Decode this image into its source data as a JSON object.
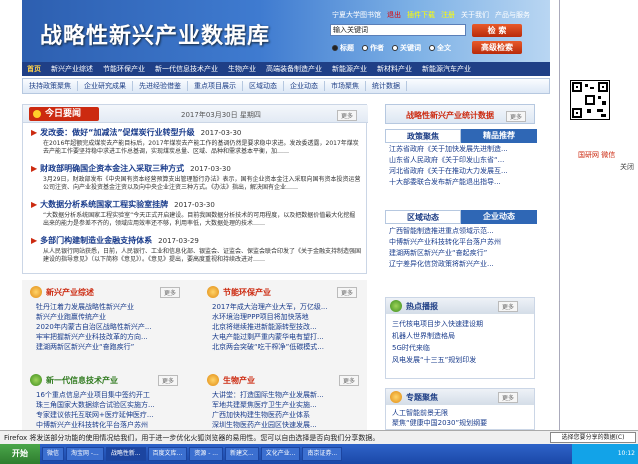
{
  "header": {
    "title": "战略性新兴产业数据库",
    "top_links": [
      "宁夏大学图书馆",
      "退出",
      "插件下载",
      "注册",
      "关于我们",
      "产品与服务"
    ],
    "search_placeholder": "输入关键词",
    "search_button": "检 索",
    "advanced_button": "高级检索",
    "radio_options": [
      "标题",
      "作者",
      "关键词",
      "全文"
    ]
  },
  "nav_primary": [
    "首页",
    "新兴产业综述",
    "节能环保产业",
    "新一代信息技术产业",
    "生物产业",
    "高端装备制造产业",
    "新能源产业",
    "新材料产业",
    "新能源汽车产业"
  ],
  "nav_secondary": [
    "扶持政策聚焦",
    "企业研究成果",
    "先进经验借鉴",
    "重点项目展示",
    "区域动态",
    "企业动态",
    "市场聚焦",
    "统计数据"
  ],
  "today_news": {
    "label": "今日要闻",
    "date": "2017年03月30日 星期四",
    "more": "更多",
    "items": [
      {
        "title": "发改委：做好“加减法”促煤炭行业转型升级",
        "date": "2017-03-30",
        "text": "在2016年超额完成煤炭去产能目标后，2017年煤炭去产能工作的基调仍然是要求稳中求进。发改委透露，2017年煤炭去产能工作要坚持稳中求进工作总基调，实现煤炭总量、区域、品种和需求基本平衡，加……"
      },
      {
        "title": "财政部明确国企资本金注入采取三种方式",
        "date": "2017-03-30",
        "text": "3月29日，财政部发布《中央国有资本经营预算支出管理暂行办法》表示，国有企业资本金注入采取向国有资本投资运营公司注资、向产业投资基金注资以及向中央企业注资三种方式。《办法》指出，解决国有企业……"
      },
      {
        "title": "大数据分析系统国家工程实验室挂牌",
        "date": "2017-03-30",
        "text": "“大数据分析系统国家工程实验室”今天正式开启建设。目前我国数据分析技术的可用程度，以及把数据价值最大化挖掘出来的能力是参差不齐的，领域应用效率还不够，利用率低，大数据处理的技术……"
      },
      {
        "title": "多部门构建制造业金融支持体系",
        "date": "2017-03-29",
        "text": "从人民银行网站获悉，日前，人民银行、工业和信息化部、银监会、证监会、保监会联合印发了《关于金融支持制造强国建设的指导意见》（以下简称《意见》）。《意见》提出，要高度重视和持续改进对……"
      }
    ]
  },
  "stats": {
    "label": "战略性新兴产业统计数据",
    "more": "更多"
  },
  "policy": {
    "tabs": [
      "政策聚焦",
      "精品推荐"
    ],
    "items": [
      "江苏省政府《关于加快发展先进制造...",
      "山东省人民政府《关于印发山东省“...",
      "河北省政府《关于在推动大力发展互...",
      "十大部委联合发布新产能退出指导..."
    ]
  },
  "region": {
    "tabs": [
      "区域动态",
      "企业动态"
    ],
    "items": [
      "广西智能制造推进重点领域示范...",
      "中博新兴产业科技转化平台落户苏州",
      "建湖两新区新兴产业“奋起疾行”",
      "辽宁差异化信贷政策将新兴产业..."
    ]
  },
  "hot": {
    "label": "热点播报",
    "more": "更多",
    "items": [
      "三代核电项目步入快速建设期",
      "机器人世界制造格局",
      "5G时代来临",
      "风电发展“十三五”规划印发"
    ]
  },
  "topic": {
    "label": "专题聚焦",
    "more": "更多",
    "items": [
      "人工智能前景无限",
      "聚焦“健康中国2030”规划纲要"
    ]
  },
  "categories": [
    {
      "label": "新兴产业综述",
      "more": "更多",
      "items": [
        "牡丹江着力发展战略性新兴产业",
        "新兴产业跑赢传统产业",
        "2020年内蒙古自治区战略性新兴产...",
        "牢牢把握新兴产业科技改革的方向...",
        "建湖两新区新兴产业“奋跑疾行”"
      ]
    },
    {
      "label": "节能环保产业",
      "more": "更多",
      "items": [
        "2017年成大治理产业大军，万亿级...",
        "水环境治理PPP项目将加快落地",
        "北京将继续推进新能源转型技改...",
        "大电产能过剩严重内蒙华电有望打...",
        "北京两会突破“吃干榨净”低碳模式..."
      ]
    },
    {
      "label": "新一代信息技术产业",
      "more": "更多",
      "items": [
        "16个重点信息产业项目集中签约开工",
        "珠三角国家大数据综合试验区实施方...",
        "专家建议依托互联网+医疗延伸医疗...",
        "中博新兴产业科技转化平台落户苏州",
        "人工智能拉动信息消费新浪潮"
      ]
    },
    {
      "label": "生物产业",
      "more": "更多",
      "items": [
        "大讲堂：打造国际生物产业发展新...",
        "军地共建聚焦医疗卫生产业实施...",
        "广西加快构建生物医药产业体系",
        "深圳生物医药产业园区快速发展...",
        "生物产业迎政策红利扩大医疗..."
      ]
    }
  ],
  "qr": {
    "caption": "国研网 微信",
    "close": "关闭"
  },
  "statusbar": {
    "text": "Firefox 将发送部分功能的使用情况给我们，用于进一步优化火狐浏览器的易用性。您可以自由选择是否向我们分享数据。",
    "button": "选择您要分享的数据(C)"
  },
  "taskbar": {
    "start": "开始",
    "tasks": [
      "微信",
      "淘宝网 -...",
      "战略性新...",
      "百度文库...",
      "资源 - ...",
      "新建文...",
      "文化产业...",
      "南京证券..."
    ],
    "active_index": 2,
    "clock": "10:12"
  }
}
